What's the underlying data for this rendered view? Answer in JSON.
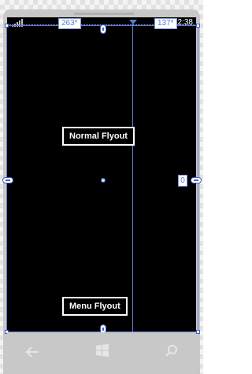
{
  "status_bar": {
    "time": "12:38"
  },
  "designer": {
    "left_column_width": "263*",
    "right_column_width": "137*",
    "margin_value": "0"
  },
  "buttons": {
    "normal_flyout": "Normal Flyout",
    "menu_flyout": "Menu Flyout"
  },
  "navbar": {
    "back_icon": "back-arrow-icon",
    "start_icon": "windows-start-icon",
    "search_icon": "search-icon"
  },
  "colors": {
    "screen": "#000000",
    "accent_guides": "#5b7bd6",
    "frame": "#c8c8c8",
    "button_border": "#ffffff"
  }
}
